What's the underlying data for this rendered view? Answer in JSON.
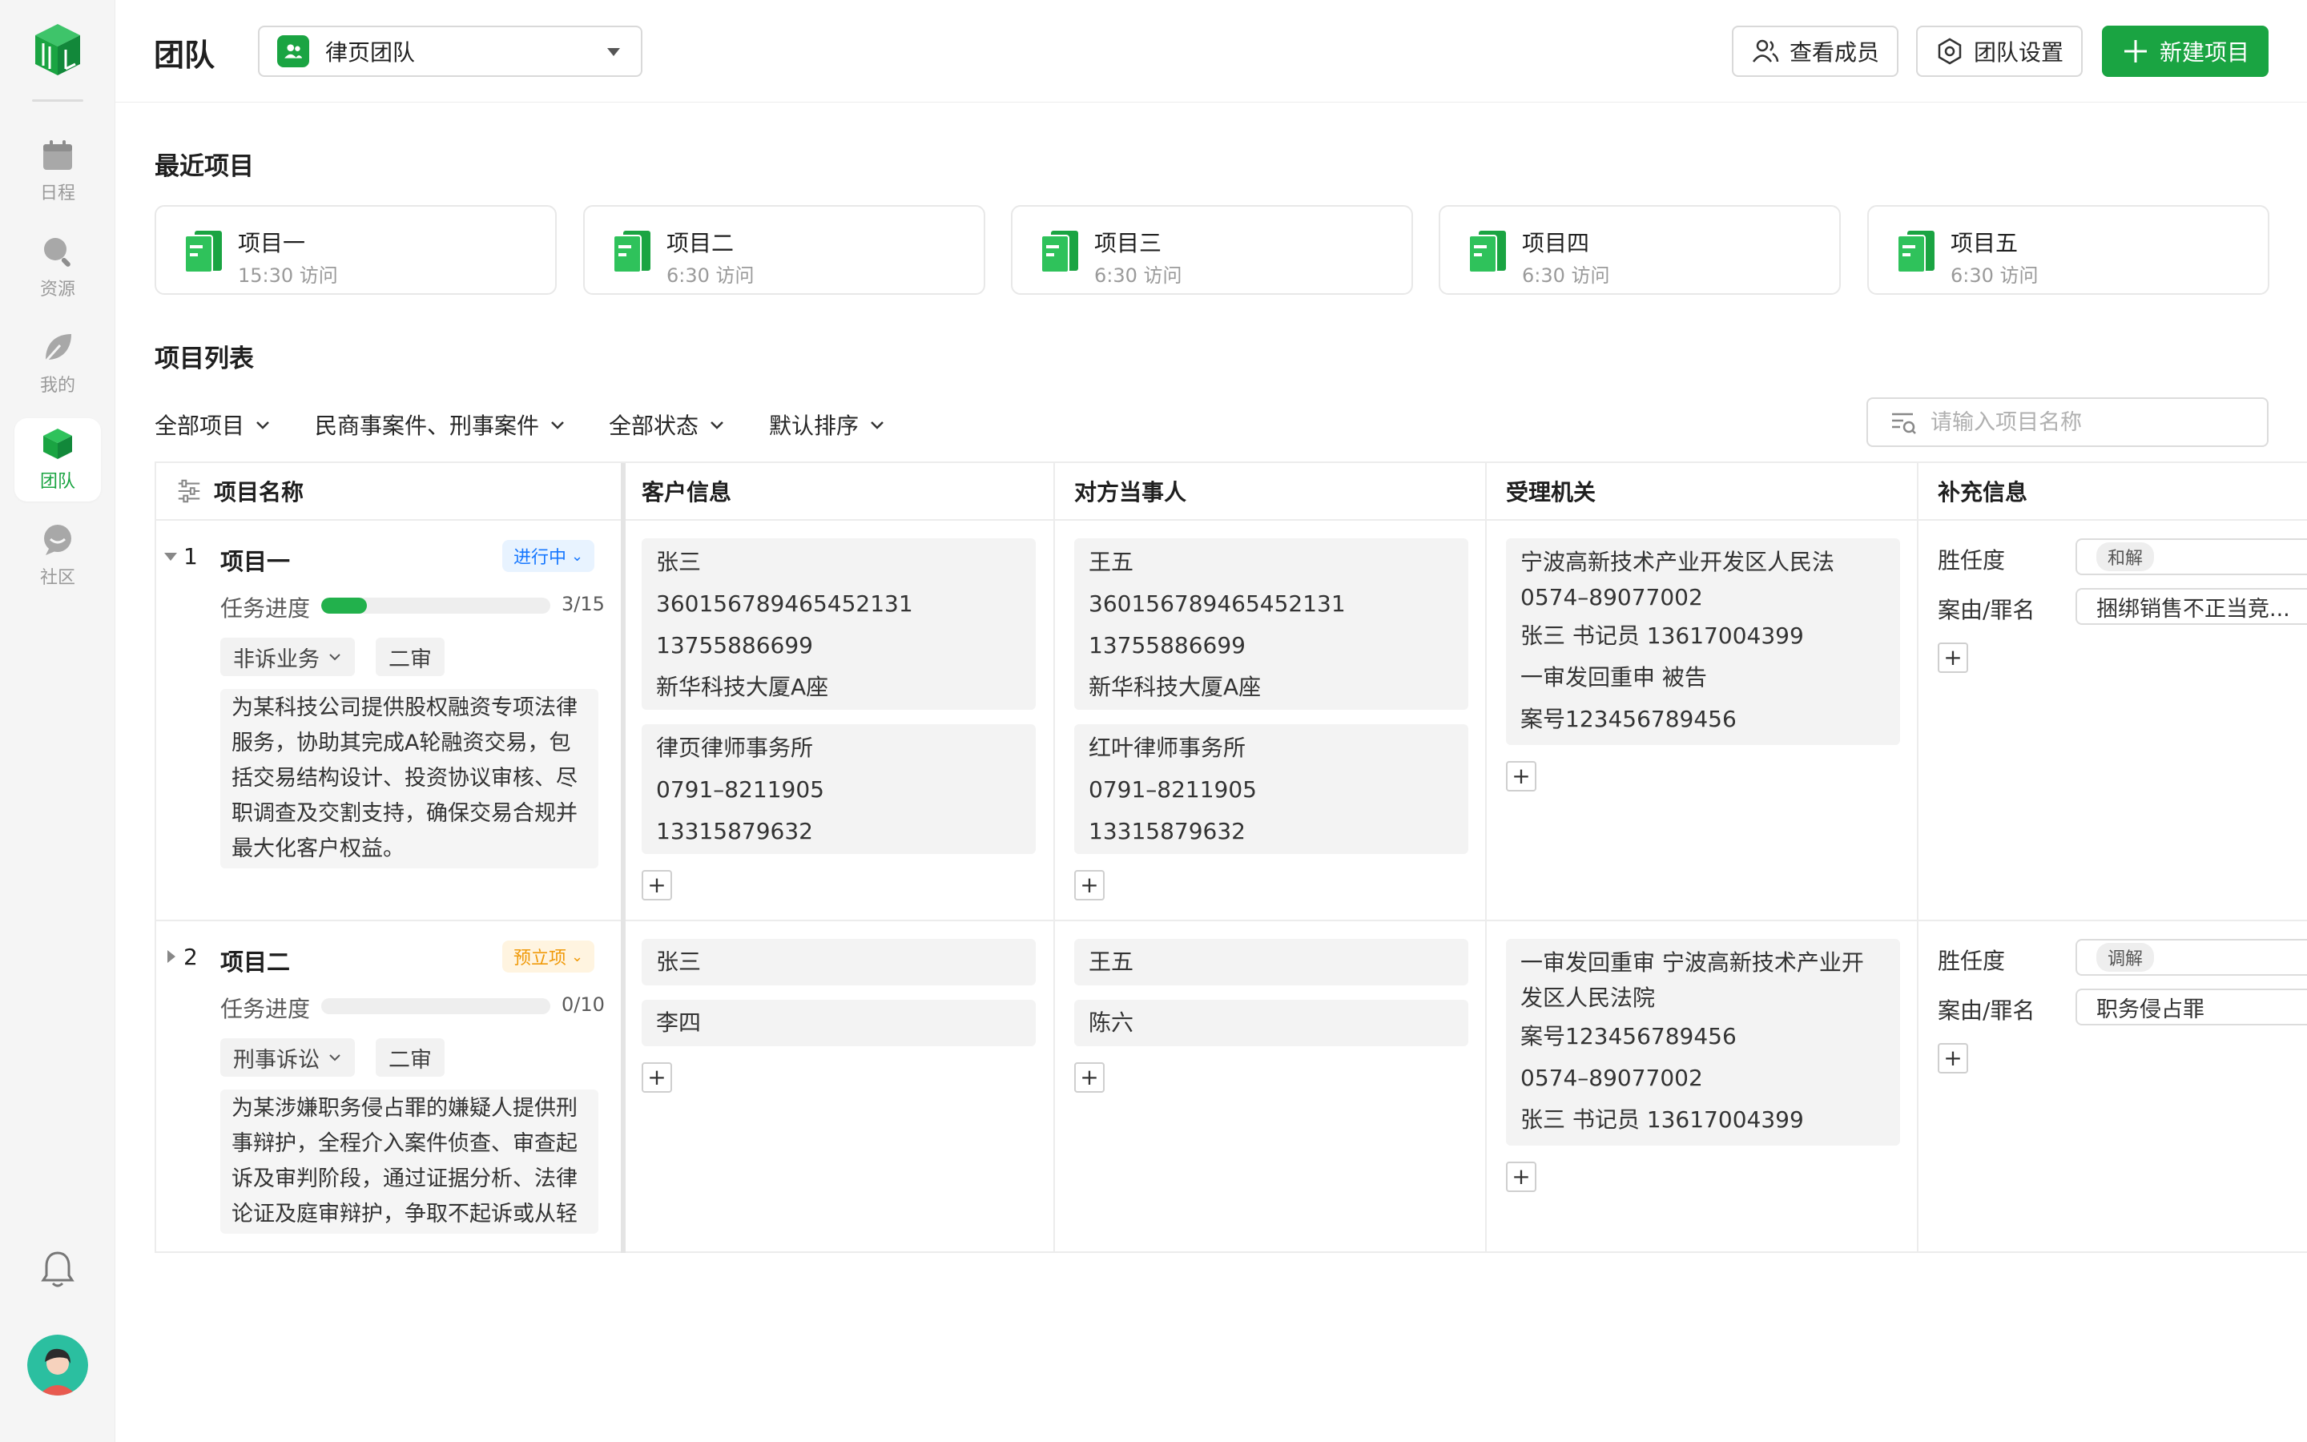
{
  "sidebar": {
    "items": [
      {
        "label": "日程",
        "icon": "calendar-icon"
      },
      {
        "label": "资源",
        "icon": "search-icon"
      },
      {
        "label": "我的",
        "icon": "leaf-icon"
      },
      {
        "label": "团队",
        "icon": "cube-icon"
      },
      {
        "label": "社区",
        "icon": "chat-icon"
      }
    ],
    "active": "团队"
  },
  "header": {
    "title": "团队",
    "team_select": "律页团队",
    "view_members": "查看成员",
    "team_settings": "团队设置",
    "new_project": "新建项目"
  },
  "recent": {
    "title": "最近项目",
    "items": [
      {
        "name": "项目一",
        "time": "15:30 访问"
      },
      {
        "name": "项目二",
        "time": "6:30 访问"
      },
      {
        "name": "项目三",
        "time": "6:30 访问"
      },
      {
        "name": "项目四",
        "time": "6:30 访问"
      },
      {
        "name": "项目五",
        "time": "6:30 访问"
      }
    ]
  },
  "list": {
    "title": "项目列表",
    "filters": [
      "全部项目",
      "民商事案件、刑事案件",
      "全部状态",
      "默认排序"
    ],
    "search_placeholder": "请输入项目名称"
  },
  "table": {
    "columns": [
      "项目名称",
      "客户信息",
      "对方当事人",
      "受理机关",
      "补充信息"
    ],
    "progress_label": "任务进度",
    "supplement_labels": [
      "胜任度",
      "案由/罪名"
    ],
    "rows": [
      {
        "num": "1",
        "name": "项目一",
        "status": "进行中",
        "progress": "3/15",
        "progress_ratio": 0.2,
        "type": "非诉业务",
        "stage": "二审",
        "desc": "为某科技公司提供股权融资专项法律服务，协助其完成A轮融资交易，包括交易结构设计、投资协议审核、尽职调查及交割支持，确保交易合规并最大化客户权益。",
        "client": [
          [
            "张三",
            "360156789465452131",
            "13755886699",
            "新华科技大厦A座"
          ],
          [
            "律页律师事务所",
            "0791–8211905",
            "13315879632"
          ]
        ],
        "opponent": [
          [
            "王五",
            "360156789465452131",
            "13755886699",
            "新华科技大厦A座"
          ],
          [
            "红叶律师事务所",
            "0791–8211905",
            "13315879632"
          ]
        ],
        "authority": [
          "宁波高新技术产业开发区人民法",
          "0574–89077002",
          "张三 书记员 13617004399",
          "一审发回重申 被告",
          "案号123456789456"
        ],
        "competence": "和解",
        "cause": "捆绑销售不正当竞..."
      },
      {
        "num": "2",
        "name": "项目二",
        "status": "预立项",
        "progress": "0/10",
        "progress_ratio": 0,
        "type": "刑事诉讼",
        "stage": "二审",
        "desc": "为某涉嫌职务侵占罪的嫌疑人提供刑事辩护，全程介入案件侦查、审查起诉及审判阶段，通过证据分析、法律论证及庭审辩护，争取不起诉或从轻",
        "client": [
          [
            "张三"
          ],
          [
            "李四"
          ]
        ],
        "opponent": [
          [
            "王五"
          ],
          [
            "陈六"
          ]
        ],
        "authority": [
          "一审发回重审 宁波高新技术产业开发区人民法院",
          "案号123456789456",
          "0574–89077002",
          "张三 书记员 13617004399"
        ],
        "competence": "调解",
        "cause": "职务侵占罪"
      }
    ]
  },
  "colors": {
    "brand": "#1aa442",
    "status_blue": "#1677ff",
    "status_orange": "#f09a0a"
  }
}
